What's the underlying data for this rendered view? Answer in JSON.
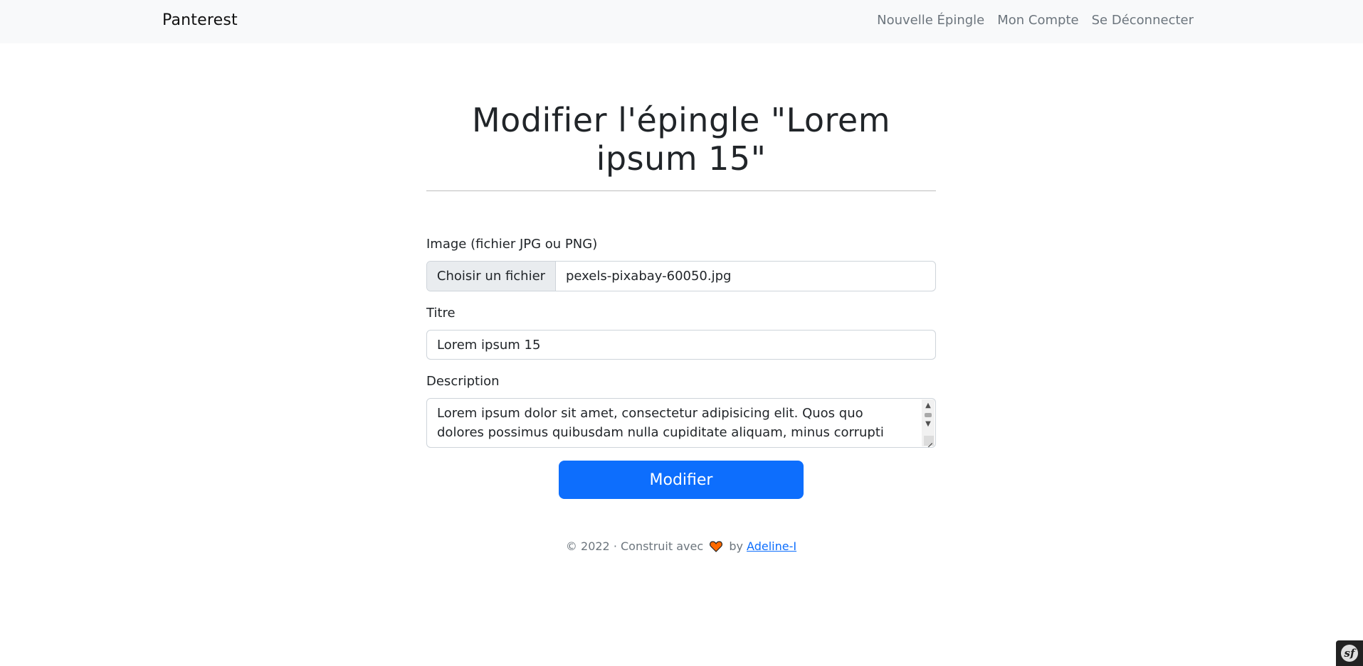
{
  "navbar": {
    "brand": "Panterest",
    "links": [
      {
        "label": "Nouvelle Épingle"
      },
      {
        "label": "Mon Compte"
      },
      {
        "label": "Se Déconnecter"
      }
    ]
  },
  "main": {
    "title_line1": "Modifier l'épingle \"Lorem",
    "title_line2": "ipsum 15\""
  },
  "form": {
    "image_label": "Image (fichier JPG ou PNG)",
    "file_button_label": "Choisir un fichier",
    "file_name": "pexels-pixabay-60050.jpg",
    "title_label": "Titre",
    "title_value": "Lorem ipsum 15",
    "description_label": "Description",
    "description_value": "Lorem ipsum dolor sit amet, consectetur adipisicing elit. Quos quo dolores possimus quibusdam nulla cupiditate aliquam, minus corrupti",
    "submit_label": "Modifier"
  },
  "footer": {
    "prefix": "© 2022 · Construit avec",
    "by": "by",
    "author_link": "Adeline-I"
  },
  "colors": {
    "primary": "#0d6efd",
    "navbar_bg": "#f8f9fa",
    "heart": "#ff6a00"
  },
  "icons": {
    "heart": "heart-icon",
    "toolbar": "symfony-icon"
  }
}
